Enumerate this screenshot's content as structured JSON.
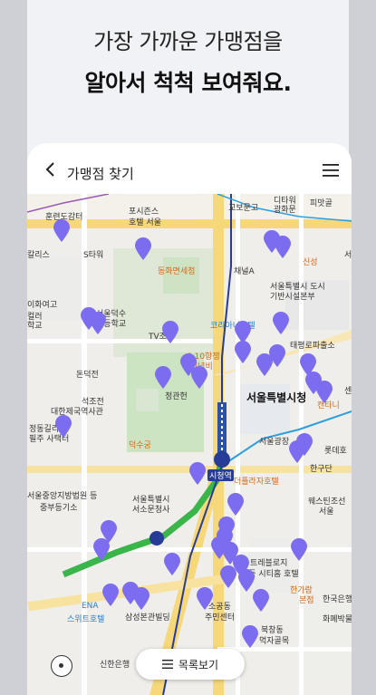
{
  "headline": {
    "line1": "가장 가까운 가맹점을",
    "line2": "알아서 척척 보여줘요."
  },
  "appbar": {
    "back_icon": "chevron-left-icon",
    "title": "가맹점 찾기",
    "menu_icon": "hamburger-icon"
  },
  "map": {
    "labels": [
      "훈련도감터",
      "포시즌스",
      "호텔 서울",
      "교보문고",
      "광화문",
      "디타워",
      "피맛골",
      "S타워",
      "동화면세점",
      "채널A",
      "신성",
      "서울특별시 도시",
      "기반시설본부",
      "코리아나호텔",
      "이화여고",
      "서울덕수",
      "초등학교",
      "태평로파출소",
      "6.10항쟁",
      "기념비",
      "돈덕전",
      "석조전",
      "대한제국역사관",
      "정관헌",
      "서울특별시청",
      "정동길리",
      "필주 사택터",
      "덕수궁",
      "서울광장",
      "한구단",
      "서울특별시",
      "서소문청사",
      "서울중앙지방법원 등",
      "중부등기소",
      "더플라자호텔",
      "웨스틴조선",
      "서울",
      "트레블로지",
      "명동 시티홈 호텔",
      "한가람",
      "본점",
      "한국은행",
      "화폐박물",
      "ENA",
      "스위트호텔",
      "삼성본관빌딩",
      "소공동",
      "주민센터",
      "북창동",
      "먹자골목",
      "신한은행",
      "캔타니",
      "롯데호",
      "TV조선",
      "컬러",
      "칼리스",
      "학교",
      "서",
      "센"
    ],
    "station_label": "시청역",
    "pin_color": "#7b6cf0",
    "line2_color": "#39b54a",
    "line1_color": "#263c96"
  },
  "controls": {
    "locate_icon": "crosshair-icon",
    "list_button_icon": "list-icon",
    "list_button_label": "목록보기"
  }
}
